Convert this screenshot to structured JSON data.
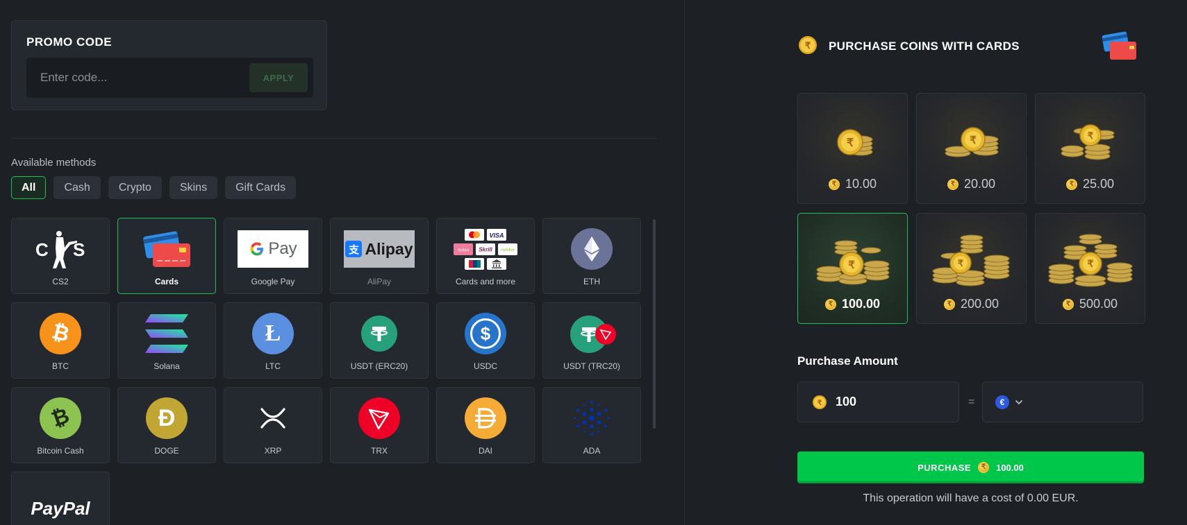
{
  "promo": {
    "title": "PROMO CODE",
    "placeholder": "Enter code...",
    "apply_label": "APPLY"
  },
  "methods": {
    "label": "Available methods",
    "filters": [
      {
        "label": "All",
        "active": true
      },
      {
        "label": "Cash",
        "active": false
      },
      {
        "label": "Crypto",
        "active": false
      },
      {
        "label": "Skins",
        "active": false
      },
      {
        "label": "Gift Cards",
        "active": false
      }
    ],
    "tiles": [
      {
        "label": "CS2",
        "icon": "cs2-logo-icon"
      },
      {
        "label": "Cards",
        "icon": "credit-cards-icon",
        "active": true
      },
      {
        "label": "Google Pay",
        "icon": "google-pay-logo-icon"
      },
      {
        "label": "AliPay",
        "icon": "alipay-logo-icon",
        "dim": true
      },
      {
        "label": "Cards and more",
        "icon": "cards-and-more-icon"
      },
      {
        "label": "ETH",
        "icon": "eth-icon"
      },
      {
        "label": "BTC",
        "icon": "btc-icon"
      },
      {
        "label": "Solana",
        "icon": "solana-icon"
      },
      {
        "label": "LTC",
        "icon": "ltc-icon"
      },
      {
        "label": "USDT (ERC20)",
        "icon": "usdt-erc20-icon"
      },
      {
        "label": "USDC",
        "icon": "usdc-icon"
      },
      {
        "label": "USDT (TRC20)",
        "icon": "usdt-trc20-icon"
      },
      {
        "label": "Bitcoin Cash",
        "icon": "bitcoin-cash-icon"
      },
      {
        "label": "DOGE",
        "icon": "doge-icon"
      },
      {
        "label": "XRP",
        "icon": "xrp-icon"
      },
      {
        "label": "TRX",
        "icon": "trx-icon"
      },
      {
        "label": "DAI",
        "icon": "dai-icon"
      },
      {
        "label": "ADA",
        "icon": "ada-icon"
      },
      {
        "label": "",
        "icon": "paypal-logo-icon"
      }
    ],
    "logo_text": {
      "cs2": "CS",
      "gpay": "Pay",
      "alipay": "Alipay",
      "paypal": "PayPal"
    },
    "mini_brands": [
      "VISA",
      "Sofort",
      "Skrill",
      "neteller"
    ]
  },
  "purchase": {
    "title": "PURCHASE COINS WITH CARDS",
    "packs": [
      {
        "value": "10.00",
        "active": false
      },
      {
        "value": "20.00",
        "active": false
      },
      {
        "value": "25.00",
        "active": false
      },
      {
        "value": "100.00",
        "active": true
      },
      {
        "value": "200.00",
        "active": false
      },
      {
        "value": "500.00",
        "active": false
      }
    ],
    "amount_label": "Purchase Amount",
    "amount_value": "100",
    "equals": "=",
    "currency_symbol": "€",
    "button_label": "PURCHASE",
    "button_value": "100.00",
    "cost_note": "This operation will have a cost of 0.00 EUR."
  },
  "colors": {
    "accent_green": "#00c64a",
    "active_border": "#1fbf55",
    "background": "#1d2025",
    "panel": "#24282f"
  }
}
